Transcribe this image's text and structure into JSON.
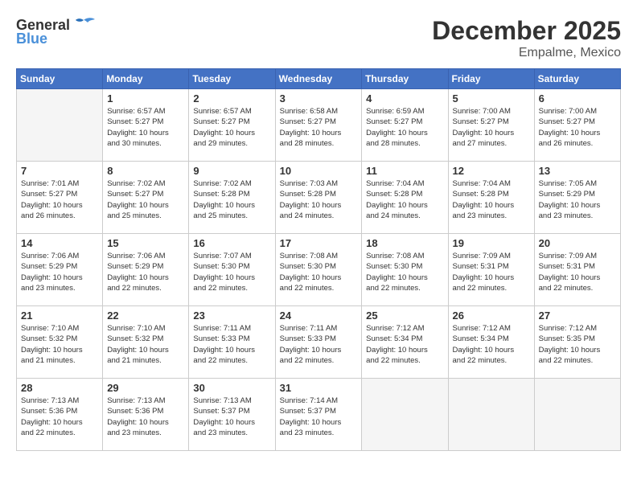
{
  "logo": {
    "general": "General",
    "blue": "Blue"
  },
  "title": "December 2025",
  "subtitle": "Empalme, Mexico",
  "days_header": [
    "Sunday",
    "Monday",
    "Tuesday",
    "Wednesday",
    "Thursday",
    "Friday",
    "Saturday"
  ],
  "weeks": [
    [
      {
        "day": "",
        "info": ""
      },
      {
        "day": "1",
        "info": "Sunrise: 6:57 AM\nSunset: 5:27 PM\nDaylight: 10 hours\nand 30 minutes."
      },
      {
        "day": "2",
        "info": "Sunrise: 6:57 AM\nSunset: 5:27 PM\nDaylight: 10 hours\nand 29 minutes."
      },
      {
        "day": "3",
        "info": "Sunrise: 6:58 AM\nSunset: 5:27 PM\nDaylight: 10 hours\nand 28 minutes."
      },
      {
        "day": "4",
        "info": "Sunrise: 6:59 AM\nSunset: 5:27 PM\nDaylight: 10 hours\nand 28 minutes."
      },
      {
        "day": "5",
        "info": "Sunrise: 7:00 AM\nSunset: 5:27 PM\nDaylight: 10 hours\nand 27 minutes."
      },
      {
        "day": "6",
        "info": "Sunrise: 7:00 AM\nSunset: 5:27 PM\nDaylight: 10 hours\nand 26 minutes."
      }
    ],
    [
      {
        "day": "7",
        "info": "Sunrise: 7:01 AM\nSunset: 5:27 PM\nDaylight: 10 hours\nand 26 minutes."
      },
      {
        "day": "8",
        "info": "Sunrise: 7:02 AM\nSunset: 5:27 PM\nDaylight: 10 hours\nand 25 minutes."
      },
      {
        "day": "9",
        "info": "Sunrise: 7:02 AM\nSunset: 5:28 PM\nDaylight: 10 hours\nand 25 minutes."
      },
      {
        "day": "10",
        "info": "Sunrise: 7:03 AM\nSunset: 5:28 PM\nDaylight: 10 hours\nand 24 minutes."
      },
      {
        "day": "11",
        "info": "Sunrise: 7:04 AM\nSunset: 5:28 PM\nDaylight: 10 hours\nand 24 minutes."
      },
      {
        "day": "12",
        "info": "Sunrise: 7:04 AM\nSunset: 5:28 PM\nDaylight: 10 hours\nand 23 minutes."
      },
      {
        "day": "13",
        "info": "Sunrise: 7:05 AM\nSunset: 5:29 PM\nDaylight: 10 hours\nand 23 minutes."
      }
    ],
    [
      {
        "day": "14",
        "info": "Sunrise: 7:06 AM\nSunset: 5:29 PM\nDaylight: 10 hours\nand 23 minutes."
      },
      {
        "day": "15",
        "info": "Sunrise: 7:06 AM\nSunset: 5:29 PM\nDaylight: 10 hours\nand 22 minutes."
      },
      {
        "day": "16",
        "info": "Sunrise: 7:07 AM\nSunset: 5:30 PM\nDaylight: 10 hours\nand 22 minutes."
      },
      {
        "day": "17",
        "info": "Sunrise: 7:08 AM\nSunset: 5:30 PM\nDaylight: 10 hours\nand 22 minutes."
      },
      {
        "day": "18",
        "info": "Sunrise: 7:08 AM\nSunset: 5:30 PM\nDaylight: 10 hours\nand 22 minutes."
      },
      {
        "day": "19",
        "info": "Sunrise: 7:09 AM\nSunset: 5:31 PM\nDaylight: 10 hours\nand 22 minutes."
      },
      {
        "day": "20",
        "info": "Sunrise: 7:09 AM\nSunset: 5:31 PM\nDaylight: 10 hours\nand 22 minutes."
      }
    ],
    [
      {
        "day": "21",
        "info": "Sunrise: 7:10 AM\nSunset: 5:32 PM\nDaylight: 10 hours\nand 21 minutes."
      },
      {
        "day": "22",
        "info": "Sunrise: 7:10 AM\nSunset: 5:32 PM\nDaylight: 10 hours\nand 21 minutes."
      },
      {
        "day": "23",
        "info": "Sunrise: 7:11 AM\nSunset: 5:33 PM\nDaylight: 10 hours\nand 22 minutes."
      },
      {
        "day": "24",
        "info": "Sunrise: 7:11 AM\nSunset: 5:33 PM\nDaylight: 10 hours\nand 22 minutes."
      },
      {
        "day": "25",
        "info": "Sunrise: 7:12 AM\nSunset: 5:34 PM\nDaylight: 10 hours\nand 22 minutes."
      },
      {
        "day": "26",
        "info": "Sunrise: 7:12 AM\nSunset: 5:34 PM\nDaylight: 10 hours\nand 22 minutes."
      },
      {
        "day": "27",
        "info": "Sunrise: 7:12 AM\nSunset: 5:35 PM\nDaylight: 10 hours\nand 22 minutes."
      }
    ],
    [
      {
        "day": "28",
        "info": "Sunrise: 7:13 AM\nSunset: 5:36 PM\nDaylight: 10 hours\nand 22 minutes."
      },
      {
        "day": "29",
        "info": "Sunrise: 7:13 AM\nSunset: 5:36 PM\nDaylight: 10 hours\nand 23 minutes."
      },
      {
        "day": "30",
        "info": "Sunrise: 7:13 AM\nSunset: 5:37 PM\nDaylight: 10 hours\nand 23 minutes."
      },
      {
        "day": "31",
        "info": "Sunrise: 7:14 AM\nSunset: 5:37 PM\nDaylight: 10 hours\nand 23 minutes."
      },
      {
        "day": "",
        "info": ""
      },
      {
        "day": "",
        "info": ""
      },
      {
        "day": "",
        "info": ""
      }
    ]
  ]
}
